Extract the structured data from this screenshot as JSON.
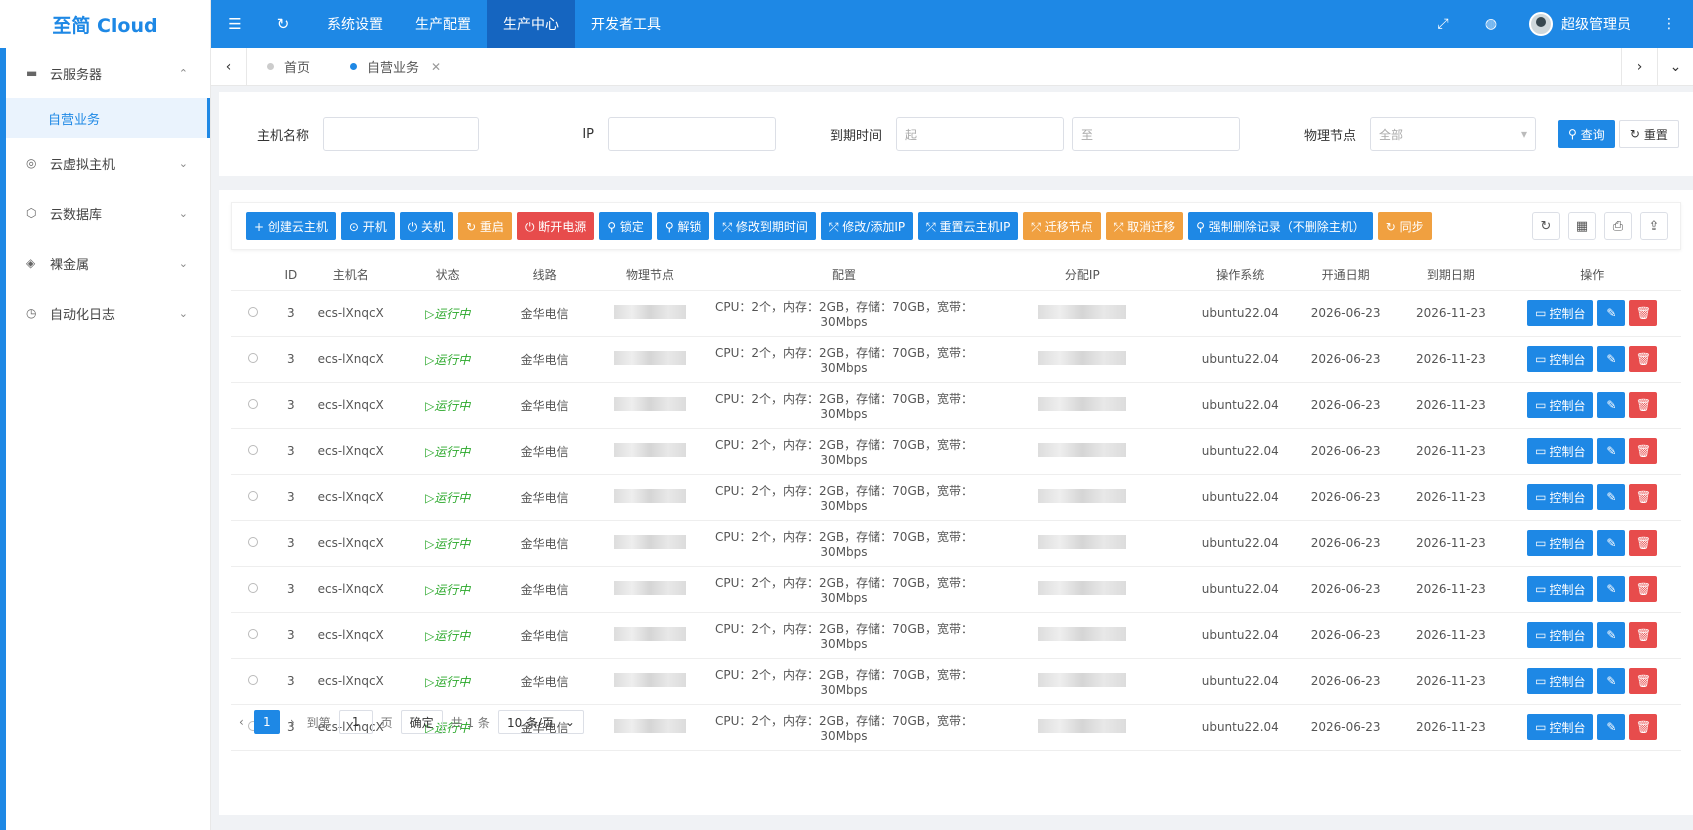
{
  "brand": "至简 Cloud",
  "top_nav": [
    "系统设置",
    "生产配置",
    "生产中心",
    "开发者工具"
  ],
  "top_nav_active": 2,
  "user_name": "超级管理员",
  "sidebar": {
    "items": [
      {
        "label": "云服务器",
        "icon": "server-icon",
        "expanded": true
      },
      {
        "label": "云虚拟主机",
        "icon": "globe-icon"
      },
      {
        "label": "云数据库",
        "icon": "database-icon"
      },
      {
        "label": "裸金属",
        "icon": "layers-icon"
      },
      {
        "label": "自动化日志",
        "icon": "clock-icon"
      }
    ],
    "sub_active": "自营业务"
  },
  "tabs": [
    {
      "label": "首页"
    },
    {
      "label": "自营业务"
    }
  ],
  "search": {
    "host_label": "主机名称",
    "ip_label": "IP",
    "expire_label": "到期时间",
    "expire_from_placeholder": "起",
    "expire_to_placeholder": "至",
    "node_label": "物理节点",
    "node_placeholder": "全部",
    "query_btn": "查询",
    "reset_btn": "重置"
  },
  "toolbar": {
    "buttons": [
      {
        "label": "+ 创建云主机",
        "color": "#1e88e5"
      },
      {
        "label": "⊙ 开机",
        "color": "#1e88e5"
      },
      {
        "label": "⏻ 关机",
        "color": "#1e88e5"
      },
      {
        "label": "↻ 重启",
        "color": "#f0a040"
      },
      {
        "label": "⏻ 断开电源",
        "color": "#e74c4c"
      },
      {
        "label": "⚲ 锁定",
        "color": "#1e88e5"
      },
      {
        "label": "⚲ 解锁",
        "color": "#1e88e5"
      },
      {
        "label": "⤱ 修改到期时间",
        "color": "#1e88e5"
      },
      {
        "label": "⤱ 修改/添加IP",
        "color": "#1e88e5"
      },
      {
        "label": "⤱ 重置云主机IP",
        "color": "#1e88e5"
      },
      {
        "label": "⤱ 迁移节点",
        "color": "#f0a040"
      },
      {
        "label": "⤱ 取消迁移",
        "color": "#f0a040"
      },
      {
        "label": "⚲ 强制删除记录（不删除主机）",
        "color": "#1e88e5"
      },
      {
        "label": "↻ 同步",
        "color": "#f0a040"
      }
    ]
  },
  "table": {
    "headers": [
      "",
      "ID",
      "主机名",
      "状态",
      "线路",
      "物理节点",
      "配置",
      "分配IP",
      "操作系统",
      "开通日期",
      "到期日期",
      "操作"
    ],
    "rows": [
      {
        "id": "3",
        "host": "ecs-lXnqcX",
        "status": "运行中",
        "line": "金华电信",
        "config": "CPU：2个，内存：2GB，存储：70GB，宽带：30Mbps",
        "os": "ubuntu22.04",
        "open": "2026-06-23",
        "expire": "2026-11-23"
      },
      {
        "id": "3",
        "host": "ecs-lXnqcX",
        "status": "运行中",
        "line": "金华电信",
        "config": "CPU：2个，内存：2GB，存储：70GB，宽带：30Mbps",
        "os": "ubuntu22.04",
        "open": "2026-06-23",
        "expire": "2026-11-23"
      },
      {
        "id": "3",
        "host": "ecs-lXnqcX",
        "status": "运行中",
        "line": "金华电信",
        "config": "CPU：2个，内存：2GB，存储：70GB，宽带：30Mbps",
        "os": "ubuntu22.04",
        "open": "2026-06-23",
        "expire": "2026-11-23"
      },
      {
        "id": "3",
        "host": "ecs-lXnqcX",
        "status": "运行中",
        "line": "金华电信",
        "config": "CPU：2个，内存：2GB，存储：70GB，宽带：30Mbps",
        "os": "ubuntu22.04",
        "open": "2026-06-23",
        "expire": "2026-11-23"
      },
      {
        "id": "3",
        "host": "ecs-lXnqcX",
        "status": "运行中",
        "line": "金华电信",
        "config": "CPU：2个，内存：2GB，存储：70GB，宽带：30Mbps",
        "os": "ubuntu22.04",
        "open": "2026-06-23",
        "expire": "2026-11-23"
      },
      {
        "id": "3",
        "host": "ecs-lXnqcX",
        "status": "运行中",
        "line": "金华电信",
        "config": "CPU：2个，内存：2GB，存储：70GB，宽带：30Mbps",
        "os": "ubuntu22.04",
        "open": "2026-06-23",
        "expire": "2026-11-23"
      },
      {
        "id": "3",
        "host": "ecs-lXnqcX",
        "status": "运行中",
        "line": "金华电信",
        "config": "CPU：2个，内存：2GB，存储：70GB，宽带：30Mbps",
        "os": "ubuntu22.04",
        "open": "2026-06-23",
        "expire": "2026-11-23"
      },
      {
        "id": "3",
        "host": "ecs-lXnqcX",
        "status": "运行中",
        "line": "金华电信",
        "config": "CPU：2个，内存：2GB，存储：70GB，宽带：30Mbps",
        "os": "ubuntu22.04",
        "open": "2026-06-23",
        "expire": "2026-11-23"
      },
      {
        "id": "3",
        "host": "ecs-lXnqcX",
        "status": "运行中",
        "line": "金华电信",
        "config": "CPU：2个，内存：2GB，存储：70GB，宽带：30Mbps",
        "os": "ubuntu22.04",
        "open": "2026-06-23",
        "expire": "2026-11-23"
      },
      {
        "id": "3",
        "host": "ecs-lXnqcX",
        "status": "运行中",
        "line": "金华电信",
        "config": "CPU：2个，内存：2GB，存储：70GB，宽带：30Mbps",
        "os": "ubuntu22.04",
        "open": "2026-06-23",
        "expire": "2026-11-23"
      }
    ],
    "console_btn": "控制台"
  },
  "pager": {
    "current": "1",
    "goto_label": "到第",
    "goto_value": "1",
    "page_label": "页",
    "confirm_btn": "确定",
    "total": "共 1 条",
    "page_size": "10 条/页"
  }
}
